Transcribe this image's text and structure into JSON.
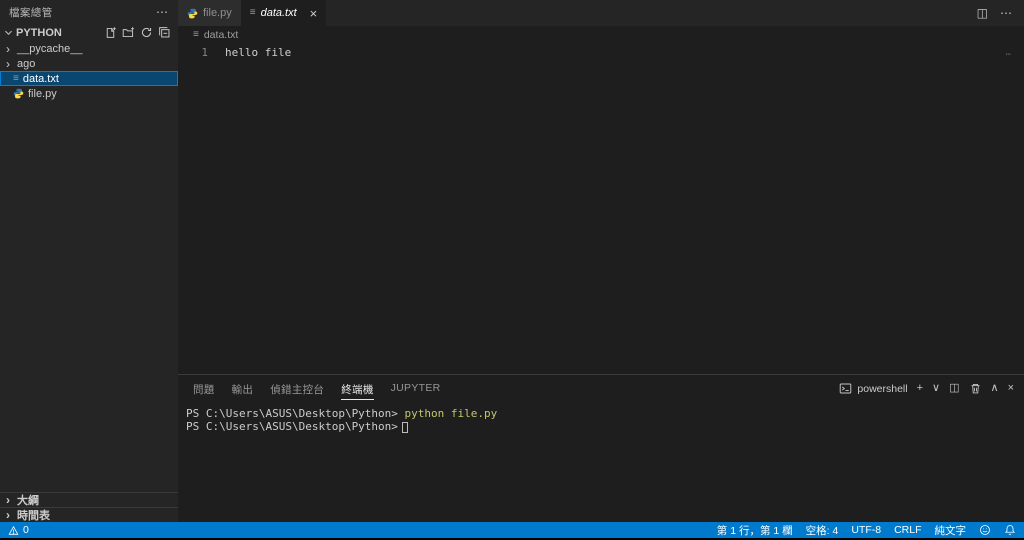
{
  "colors": {
    "accent": "#007acc",
    "editor-bg": "#1e1e1e",
    "sidebar-bg": "#252526",
    "tabbar-bg": "#252526",
    "tab-inactive-bg": "#2d2d2d",
    "selection-bg": "#094771",
    "selection-border": "#007fd4",
    "command-yellow": "#c5c56f"
  },
  "icons": {
    "more": "⋯",
    "close": "×",
    "add": "+",
    "chevron_down": "∨",
    "chevron_up": "∧",
    "chevron_right": "›",
    "split_editor": "◫",
    "file": "≡",
    "minimap_dots": "⋯"
  },
  "sidebar": {
    "title": "檔案總管",
    "section": "PYTHON",
    "items": [
      {
        "label": "__pycache__",
        "type": "folder"
      },
      {
        "label": "ago",
        "type": "folder"
      },
      {
        "label": "data.txt",
        "type": "file",
        "selected": true
      },
      {
        "label": "file.py",
        "type": "python-file"
      }
    ],
    "bottom_sections": [
      {
        "label": "大綱"
      },
      {
        "label": "時間表"
      }
    ]
  },
  "editor_tabs": [
    {
      "label": "file.py",
      "active": false
    },
    {
      "label": "data.txt",
      "active": true,
      "preview": true
    }
  ],
  "breadcrumb": {
    "file": "data.txt"
  },
  "editor": {
    "line_number": "1",
    "line_text": "hello file"
  },
  "panel": {
    "tabs": [
      {
        "label": "問題"
      },
      {
        "label": "輸出"
      },
      {
        "label": "偵錯主控台"
      },
      {
        "label": "終端機",
        "active": true
      },
      {
        "label": "JUPYTER"
      }
    ],
    "shell_label": "powershell",
    "terminal": {
      "line1_prompt": "PS C:\\Users\\ASUS\\Desktop\\Python>",
      "line1_command": " python file.py",
      "line2_prompt": "PS C:\\Users\\ASUS\\Desktop\\Python>"
    }
  },
  "status_bar": {
    "problems_count": "0",
    "line_col": "第 1 行，第 1 欄",
    "indent": "空格: 4",
    "encoding": "UTF-8",
    "eol": "CRLF",
    "language": "純文字"
  }
}
